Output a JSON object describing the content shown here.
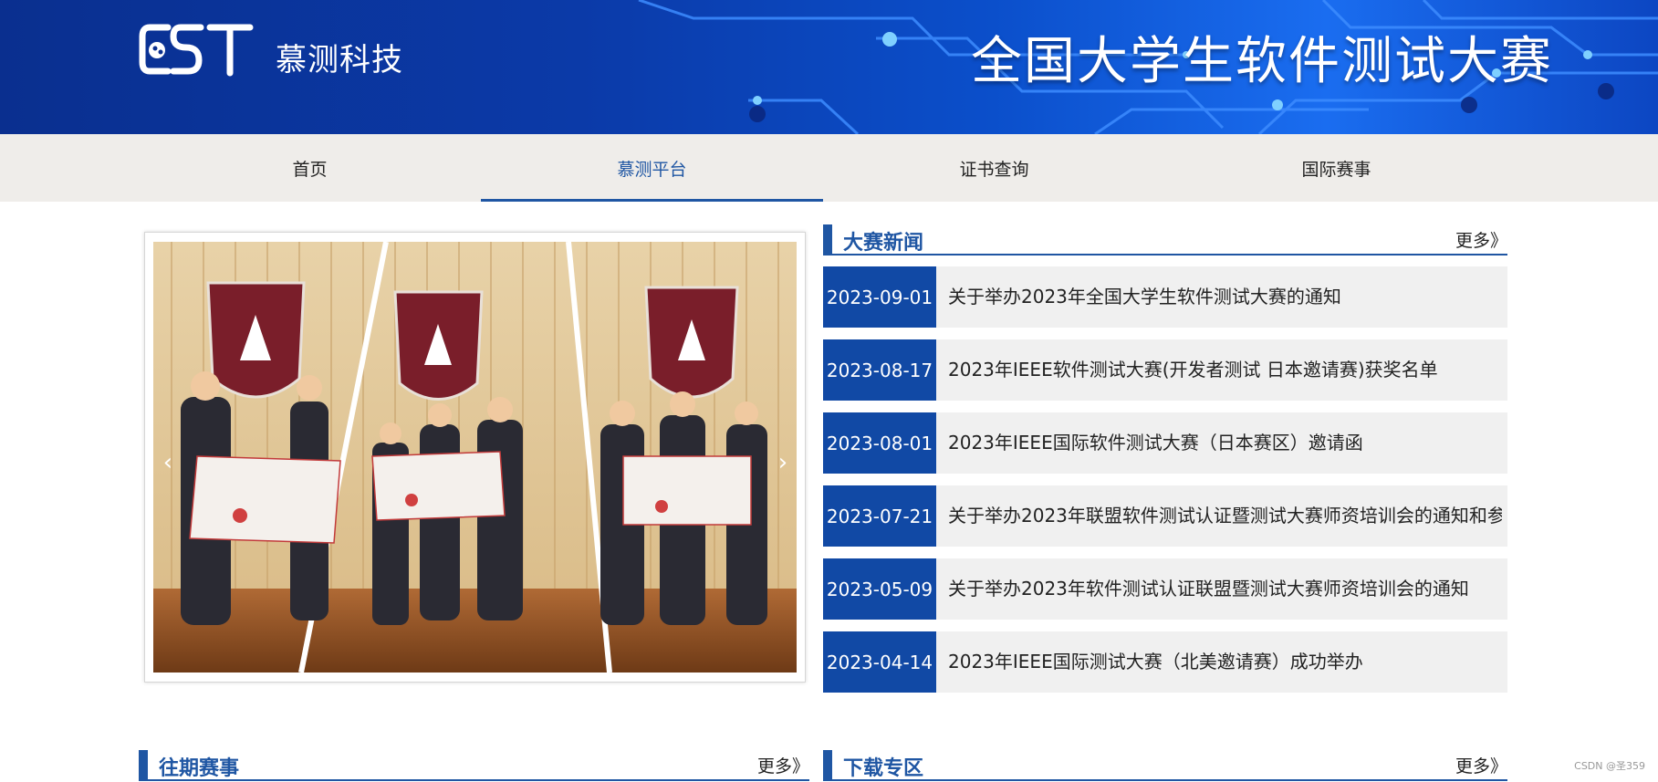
{
  "banner": {
    "logo_text": "CST",
    "brand": "慕测科技",
    "title": "全国大学生软件测试大赛"
  },
  "nav": {
    "items": [
      {
        "label": "首页",
        "active": false
      },
      {
        "label": "慕测平台",
        "active": true
      },
      {
        "label": "证书查询",
        "active": false
      },
      {
        "label": "国际赛事",
        "active": false
      }
    ]
  },
  "slider": {
    "image_desc": "award-ceremony-photo",
    "prev_icon": "chevron-left-icon",
    "next_icon": "chevron-right-icon"
  },
  "sections": {
    "news": {
      "title": "大赛新闻",
      "more": "更多》"
    },
    "past": {
      "title": "往期赛事",
      "more": "更多》"
    },
    "download": {
      "title": "下载专区",
      "more": "更多》"
    }
  },
  "news": [
    {
      "date": "2023-09-01",
      "text": "关于举办2023年全国大学生软件测试大赛的通知"
    },
    {
      "date": "2023-08-17",
      "text": "2023年IEEE软件测试大赛(开发者测试 日本邀请赛)获奖名单"
    },
    {
      "date": "2023-08-01",
      "text": "2023年IEEE国际软件测试大赛（日本赛区）邀请函"
    },
    {
      "date": "2023-07-21",
      "text": "关于举办2023年联盟软件测试认证暨测试大赛师资培训会的通知和参"
    },
    {
      "date": "2023-05-09",
      "text": "关于举办2023年软件测试认证联盟暨测试大赛师资培训会的通知"
    },
    {
      "date": "2023-04-14",
      "text": "2023年IEEE国际测试大赛（北美邀请赛）成功举办"
    }
  ],
  "watermark": "CSDN @圣359",
  "colors": {
    "primary": "#1f56a3",
    "date_bg": "#1149a5",
    "nav_bg": "#efedea",
    "row_bg": "#f0f0f0"
  }
}
